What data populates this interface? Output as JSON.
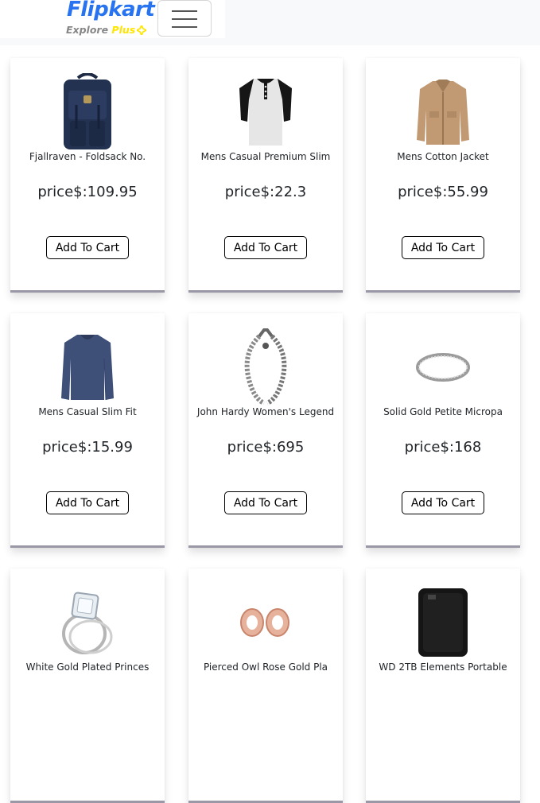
{
  "header": {
    "logo_text": "Flipkart",
    "logo_tagline_prefix": "Explore ",
    "logo_tagline_plus": "Plus",
    "brand_color": "#2874f0",
    "tagline_plus_color": "#ffe500"
  },
  "products": [
    {
      "title": "Fjallraven - Foldsack No.",
      "price_label": "price$:109.95",
      "button": "Add To Cart",
      "image": "backpack-image"
    },
    {
      "title": "Mens Casual Premium Slim",
      "price_label": "price$:22.3",
      "button": "Add To Cart",
      "image": "tshirt-image"
    },
    {
      "title": "Mens Cotton Jacket",
      "price_label": "price$:55.99",
      "button": "Add To Cart",
      "image": "jacket-image"
    },
    {
      "title": "Mens Casual Slim Fit",
      "price_label": "price$:15.99",
      "button": "Add To Cart",
      "image": "long-sleeve-shirt-image"
    },
    {
      "title": "John Hardy Women's Legend",
      "price_label": "price$:695",
      "button": "Add To Cart",
      "image": "bracelet-image"
    },
    {
      "title": "Solid Gold Petite Micropa",
      "price_label": "price$:168",
      "button": "Add To Cart",
      "image": "ring-image"
    },
    {
      "title": "White Gold Plated Princes",
      "price_label": "",
      "button": "",
      "image": "diamond-ring-image"
    },
    {
      "title": "Pierced Owl Rose Gold Pla",
      "price_label": "",
      "button": "",
      "image": "rose-gold-earrings-image"
    },
    {
      "title": "WD 2TB Elements Portable",
      "price_label": "",
      "button": "",
      "image": "hard-drive-image"
    }
  ]
}
